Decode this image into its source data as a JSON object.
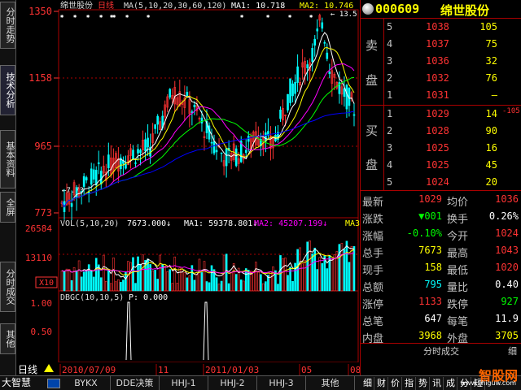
{
  "sidebar": {
    "tabs": [
      {
        "label": "分时走势",
        "top": 2,
        "height": 58
      },
      {
        "label": "技术分析",
        "top": 80,
        "height": 62,
        "active": true
      },
      {
        "label": "基本资料",
        "top": 160,
        "height": 72
      },
      {
        "label": "全屏",
        "top": 236,
        "height": 38
      },
      {
        "label": "分时成交",
        "top": 322,
        "height": 62
      },
      {
        "label": "其他",
        "top": 398,
        "height": 38
      }
    ]
  },
  "chart": {
    "title_stock": "绵世股份",
    "title_period": "日线",
    "ma_label": "MA(5,10,20,30,60,120)",
    "ma1_label": "MA1: 10.718",
    "ma2_label": "MA2: 10.746",
    "high_marker": "13.5",
    "low_marker": "7.73",
    "price_axis": [
      "1350",
      "1158",
      "965",
      "773"
    ],
    "vol_label": "VOL(5,10,20)",
    "vol_value": "7673.000↓",
    "vol_ma1": "MA1: 59378.801↓",
    "vol_ma2": "MA2: 45207.199↓",
    "vol_ma3": "MA3",
    "vol_axis": [
      "26584",
      "13110"
    ],
    "vol_unit": "X10",
    "ind_label": "DBGC(10,10,5)",
    "ind_value": "P: 0.000",
    "ind_axis": [
      "1.00",
      "0.50"
    ],
    "period_label": "日线",
    "dates": [
      "2010/07/09",
      "11",
      "2011/01/03",
      "05",
      "08"
    ]
  },
  "chart_data": {
    "type": "candlestick",
    "ylim": [
      773,
      1350
    ],
    "annotations": {
      "high": 13.5,
      "low": 7.73
    },
    "ma_values": {
      "MA1": 10.718,
      "MA2": 10.746
    },
    "volume": {
      "current": 7673.0,
      "MA1": 59378.801,
      "MA2": 45207.199,
      "ylim_ticks": [
        13110,
        26584
      ],
      "unit": "X10"
    },
    "indicator": {
      "name": "DBGC(10,10,5)",
      "P": 0.0,
      "ylim": [
        0,
        1
      ]
    }
  },
  "panel": {
    "code": "000609",
    "name": "绵世股份",
    "sell_label": [
      "卖",
      "盘"
    ],
    "buy_label": [
      "买",
      "盘"
    ],
    "sell": [
      {
        "lvl": "5",
        "px": "1038",
        "vol": "105"
      },
      {
        "lvl": "4",
        "px": "1037",
        "vol": "75"
      },
      {
        "lvl": "3",
        "px": "1036",
        "vol": "32"
      },
      {
        "lvl": "2",
        "px": "1032",
        "vol": "76"
      },
      {
        "lvl": "1",
        "px": "1031",
        "vol": "—"
      }
    ],
    "buy": [
      {
        "lvl": "1",
        "px": "1029",
        "vol": "14"
      },
      {
        "lvl": "2",
        "px": "1028",
        "vol": "90"
      },
      {
        "lvl": "3",
        "px": "1025",
        "vol": "16"
      },
      {
        "lvl": "4",
        "px": "1025",
        "vol": "45"
      },
      {
        "lvl": "5",
        "px": "1024",
        "vol": "20"
      }
    ],
    "buy1_extra": "-105",
    "stats": [
      {
        "l1": "最新",
        "v1": "1029",
        "c1": "#ff3333",
        "l2": "均价",
        "v2": "1036",
        "c2": "#ff3333"
      },
      {
        "l1": "涨跌",
        "v1": "▼001",
        "c1": "#00ff00",
        "l2": "换手",
        "v2": "0.26%",
        "c2": "#ffffff"
      },
      {
        "l1": "涨幅",
        "v1": "-0.10%",
        "c1": "#00ff00",
        "l2": "今开",
        "v2": "1024",
        "c2": "#ff3333"
      },
      {
        "l1": "总手",
        "v1": "7673",
        "c1": "#ffff00",
        "l2": "最高",
        "v2": "1043",
        "c2": "#ff3333"
      },
      {
        "l1": "现手",
        "v1": "158",
        "c1": "#ffff00",
        "l2": "最低",
        "v2": "1020",
        "c2": "#ff3333"
      },
      {
        "l1": "总额",
        "v1": "795",
        "c1": "#00ffff",
        "l2": "量比",
        "v2": "0.40",
        "c2": "#ffffff"
      },
      {
        "l1": "涨停",
        "v1": "1133",
        "c1": "#ff3333",
        "l2": "跌停",
        "v2": "927",
        "c2": "#00ff00"
      },
      {
        "l1": "总笔",
        "v1": "647",
        "c1": "#ffffff",
        "l2": "每笔",
        "v2": "11.9",
        "c2": "#ffffff"
      },
      {
        "l1": "内盘",
        "v1": "3968",
        "c1": "#ffff00",
        "l2": "外盘",
        "v2": "3705",
        "c2": "#ffff00"
      }
    ],
    "footer": "分时成交",
    "footer_right": "细"
  },
  "bottombar": {
    "brand": "大智慧",
    "items": [
      "BYKX",
      "DDE决策",
      "HHJ-1",
      "HHJ-2",
      "HHJ-3",
      "其他"
    ]
  },
  "bottom_right_tabs": [
    "细",
    "财",
    "价",
    "指",
    "势",
    "讯",
    "成",
    "分",
    "短"
  ],
  "logo": "智股网",
  "logo_sub": "www.zhiguw.com",
  "colors": {
    "up": "#ff3333",
    "down": "#00ffff",
    "ma5": "#ffffff",
    "ma10": "#ffff00",
    "ma20": "#ff00ff",
    "ma30": "#00ff00",
    "ma60": "#0000ff",
    "grid": "#aa0000"
  }
}
